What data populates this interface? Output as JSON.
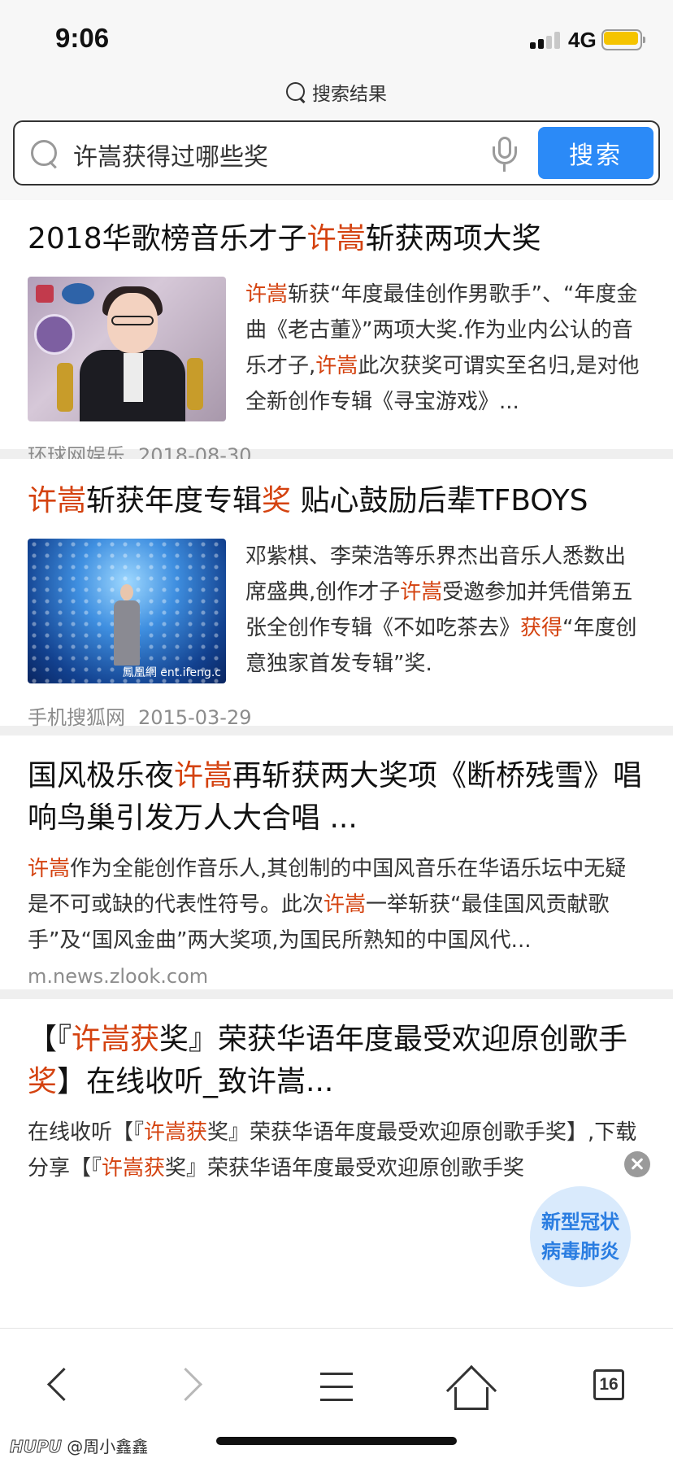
{
  "status_bar": {
    "time": "9:06",
    "network": "4G",
    "signal_bars_filled": 2,
    "signal_bars_total": 4,
    "battery_level": 0.85,
    "battery_color": "#f5c400"
  },
  "header": {
    "title": "搜索结果",
    "title_icon": "search-icon"
  },
  "search": {
    "query": "许嵩获得过哪些奖",
    "button_label": "搜索",
    "button_color": "#2b8af7"
  },
  "highlight_color": "#d4420f",
  "results": [
    {
      "title": [
        {
          "text": "2018华歌榜音乐才子",
          "hl": false
        },
        {
          "text": "许嵩",
          "hl": true
        },
        {
          "text": "斩获两项大奖",
          "hl": false
        }
      ],
      "snippet": [
        {
          "text": "许嵩",
          "hl": true
        },
        {
          "text": "斩获“年度最佳创作男歌手”、“年度金曲《老古董》”两项大奖.作为业内公认的音乐才子,",
          "hl": false
        },
        {
          "text": "许嵩",
          "hl": true
        },
        {
          "text": "此次获奖可谓实至名归,是对他全新创作专辑《寻宝游戏》...",
          "hl": false
        }
      ],
      "source": "环球网娱乐",
      "date": "2018-08-30"
    },
    {
      "title": [
        {
          "text": "许嵩",
          "hl": true
        },
        {
          "text": "斩获年度专辑",
          "hl": false
        },
        {
          "text": "奖",
          "hl": true
        },
        {
          "text": " 贴心鼓励后辈TFBOYS",
          "hl": false
        }
      ],
      "snippet": [
        {
          "text": "邓紫棋、李荣浩等乐界杰出音乐人悉数出席盛典,创作才子",
          "hl": false
        },
        {
          "text": "许嵩",
          "hl": true
        },
        {
          "text": "受邀参加并凭借第五张全创作专辑《不如吃茶去》",
          "hl": false
        },
        {
          "text": "获得",
          "hl": true
        },
        {
          "text": "“年度创意独家首发专辑”奖.",
          "hl": false
        }
      ],
      "thumb_watermark": "鳳凰網 ent.ifeng.c",
      "source": "手机搜狐网",
      "date": "2015-03-29"
    },
    {
      "title": [
        {
          "text": "国风极乐夜",
          "hl": false
        },
        {
          "text": "许嵩",
          "hl": true
        },
        {
          "text": "再斩获两大奖项《断桥残雪》唱响鸟巢引发万人大合唱 ...",
          "hl": false
        }
      ],
      "snippet": [
        {
          "text": "许嵩",
          "hl": true
        },
        {
          "text": "作为全能创作音乐人,其创制的中国风音乐在华语乐坛中无疑是不可或缺的代表性符号。此次",
          "hl": false
        },
        {
          "text": "许嵩",
          "hl": true
        },
        {
          "text": "一举斩获“最佳国风贡献歌手”及“国风金曲”两大奖项,为国民所熟知的中国风代...",
          "hl": false
        }
      ],
      "url": "m.news.zlook.com"
    },
    {
      "title": [
        {
          "text": "【『",
          "hl": false
        },
        {
          "text": "许嵩获",
          "hl": true
        },
        {
          "text": "奖』荣获华语年度最受欢迎原创歌手",
          "hl": false
        },
        {
          "text": "奖",
          "hl": true
        },
        {
          "text": "】在线收听_致许嵩...",
          "hl": false
        }
      ],
      "snippet": [
        {
          "text": "在线收听【『",
          "hl": false
        },
        {
          "text": "许嵩获",
          "hl": true
        },
        {
          "text": "奖』荣获华语年度最受欢迎原创歌手奖】,下载分享【『",
          "hl": false
        },
        {
          "text": "许嵩获",
          "hl": true
        },
        {
          "text": "奖』荣获华语年度最受欢迎原创歌手奖",
          "hl": false
        }
      ]
    }
  ],
  "floating_badge": {
    "text_line1": "新型冠状",
    "text_line2": "病毒肺炎"
  },
  "bottom_nav": {
    "items": [
      "back-icon",
      "forward-icon",
      "menu-icon",
      "home-icon",
      "tabs-icon"
    ],
    "tab_count": "16"
  },
  "watermark": {
    "brand": "HUPU",
    "user": "@周小鑫鑫"
  }
}
